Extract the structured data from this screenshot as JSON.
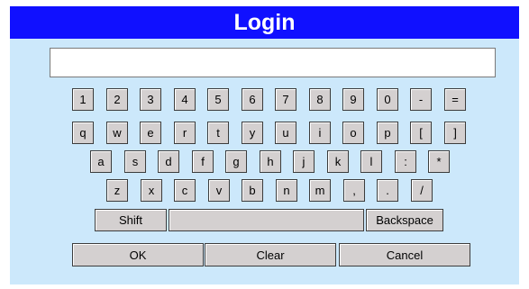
{
  "title": "Login",
  "input": {
    "value": "",
    "placeholder": ""
  },
  "keyboard": {
    "rows": [
      [
        "1",
        "2",
        "3",
        "4",
        "5",
        "6",
        "7",
        "8",
        "9",
        "0",
        "-",
        "="
      ],
      [
        "q",
        "w",
        "e",
        "r",
        "t",
        "y",
        "u",
        "i",
        "o",
        "p",
        "[",
        "]"
      ],
      [
        "a",
        "s",
        "d",
        "f",
        "g",
        "h",
        "j",
        "k",
        "l",
        ":",
        "*"
      ],
      [
        "z",
        "x",
        "c",
        "v",
        "b",
        "n",
        "m",
        ",",
        ".",
        "/"
      ]
    ],
    "shift_label": "Shift",
    "space_label": "",
    "backspace_label": "Backspace"
  },
  "actions": {
    "ok_label": "OK",
    "clear_label": "Clear",
    "cancel_label": "Cancel"
  },
  "colors": {
    "title_bar": "#1010ff",
    "panel": "#cce8fb",
    "key": "#d4d0d0"
  }
}
